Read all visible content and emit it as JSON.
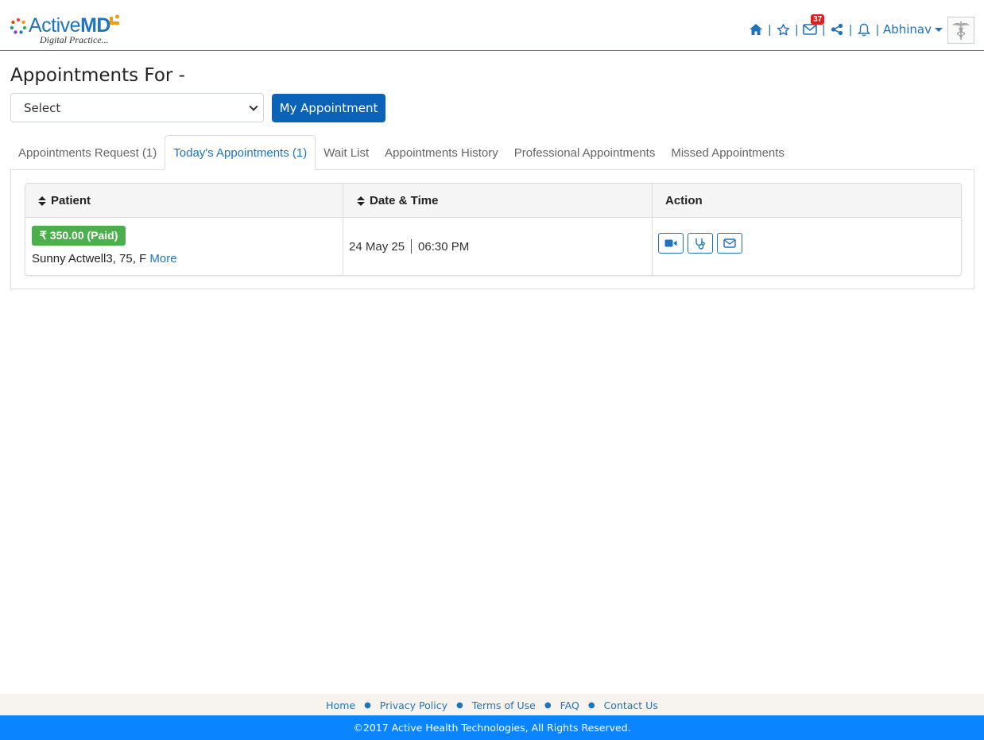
{
  "brand": {
    "name_prefix": "Active",
    "name_suffix": "MD",
    "tagline": "Digital Practice...",
    "accent": "#1e73be",
    "accent_orange": "#f39c12"
  },
  "header": {
    "icons": [
      "home-icon",
      "star-icon",
      "mail-icon",
      "share-icon",
      "bell-icon"
    ],
    "mail_badge": "37",
    "user_name": "Abhinav"
  },
  "page": {
    "title": "Appointments For -",
    "select_value": "Select",
    "my_appointment_label": "My Appointment"
  },
  "tabs": [
    {
      "label": "Appointments Request (1)",
      "active": false
    },
    {
      "label": "Today's Appointments (1)",
      "active": true
    },
    {
      "label": "Wait List",
      "active": false
    },
    {
      "label": "Appointments History",
      "active": false
    },
    {
      "label": "Professional Appointments",
      "active": false
    },
    {
      "label": "Missed Appointments",
      "active": false
    }
  ],
  "table": {
    "columns": [
      "Patient",
      "Date & Time",
      "Action"
    ],
    "rows": [
      {
        "payment_badge": "₹ 350.00 (Paid)",
        "patient": "Sunny Actwell3, 75, F",
        "more_label": "More",
        "date": "24 May 25",
        "time": "06:30 PM",
        "actions": [
          "video-call-icon",
          "stethoscope-icon",
          "message-icon"
        ]
      }
    ]
  },
  "footer": {
    "links": [
      "Home",
      "Privacy Policy",
      "Terms of Use",
      "FAQ",
      "Contact Us"
    ],
    "copyright": "©2017 Active Health Technologies, All Rights Reserved."
  },
  "colors": {
    "primary_button": "#0b63b8",
    "paid_badge": "#4cae4c",
    "footer_bar": "#0a84ff",
    "badge_red": "#e02020"
  }
}
